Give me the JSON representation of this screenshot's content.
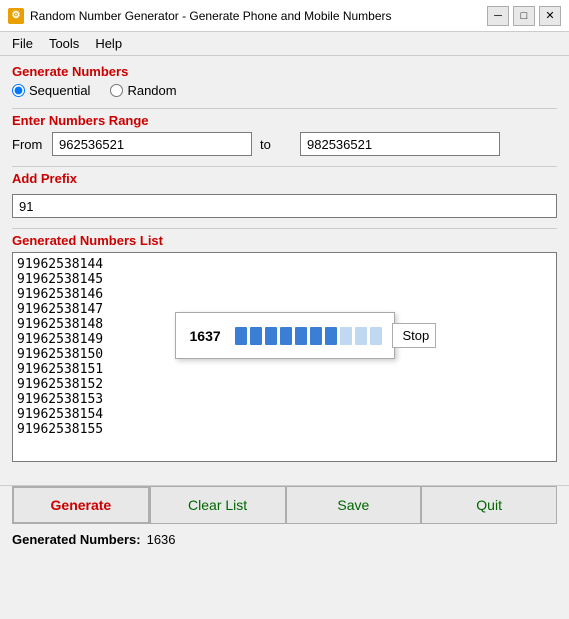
{
  "titleBar": {
    "title": "Random Number Generator - Generate Phone and Mobile Numbers",
    "icon": "#",
    "minimize": "─",
    "maximize": "□",
    "close": "✕"
  },
  "menuBar": {
    "items": [
      "File",
      "Tools",
      "Help"
    ]
  },
  "generateNumbers": {
    "label": "Generate Numbers",
    "sequential": "Sequential",
    "random": "Random",
    "sequentialChecked": true
  },
  "numberRange": {
    "label": "Enter Numbers Range",
    "fromLabel": "From",
    "fromValue": "962536521",
    "toLabel": "to",
    "toValue": "982536521"
  },
  "prefix": {
    "label": "Add Prefix",
    "value": "91"
  },
  "generatedList": {
    "label": "Generated Numbers List",
    "numbers": [
      "91962538144",
      "91962538145",
      "91962538146",
      "91962538147",
      "91962538148",
      "91962538149",
      "91962538150",
      "91962538151",
      "91962538152",
      "91962538153",
      "91962538154",
      "91962538155"
    ]
  },
  "progressOverlay": {
    "count": "1637",
    "segments": 10,
    "filledSegments": 7,
    "stopLabel": "Stop"
  },
  "buttons": {
    "generate": "Generate",
    "clearList": "Clear List",
    "save": "Save",
    "quit": "Quit"
  },
  "statusBar": {
    "label": "Generated Numbers:",
    "value": "1636"
  }
}
